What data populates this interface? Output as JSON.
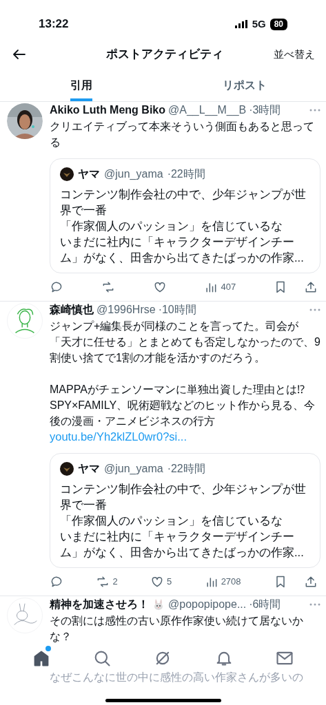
{
  "status_bar": {
    "time": "13:22",
    "network": "5G",
    "battery": "80"
  },
  "header": {
    "title": "ポストアクティビティ",
    "action": "並べ替え"
  },
  "tabs": [
    {
      "label": "引用",
      "selected": true
    },
    {
      "label": "リポスト",
      "selected": false
    }
  ],
  "posts": [
    {
      "name": "Akiko Luth Meng Biko",
      "name_badge": false,
      "handle": "@A__L__M__B",
      "time": "·3時間",
      "text": [
        "クリエイティブって本来そういう側面もあると思ってる"
      ],
      "quote": {
        "name": "ヤマ",
        "handle": "@jun_yama",
        "time": "·22時間",
        "text": [
          "コンテンツ制作会社の中で、少年ジャンプが世界で一番",
          "「作家個人のパッション」を信じているな",
          "いまだに社内に「キャラクターデザインチーム」がなく、田舎から出てきたばっかの作家..."
        ]
      },
      "stats": {
        "views": "407"
      }
    },
    {
      "name": "森崎慎也",
      "name_badge": false,
      "handle": "@1996Hrse",
      "time": "·10時間",
      "text": [
        "ジャンプ+編集長が同様のことを言ってた。司会が「天才に任せる」とまとめても否定しなかったので、9割使い捨てで1割の才能を活かすのだろう。",
        "MAPPAがチェンソーマンに単独出資した理由とは⁉ SPY×FAMILY、呪術廻戦などのヒット作から見る、今後の漫画・アニメビジネスの行方"
      ],
      "link": "youtu.be/Yh2klZL0wr0?si...",
      "quote": {
        "name": "ヤマ",
        "handle": "@jun_yama",
        "time": "·22時間",
        "text": [
          "コンテンツ制作会社の中で、少年ジャンプが世界で一番",
          "「作家個人のパッション」を信じているな",
          "いまだに社内に「キャラクターデザインチーム」がなく、田舎から出てきたばっかの作家..."
        ]
      },
      "stats": {
        "reposts": "2",
        "likes": "5",
        "views": "2708"
      }
    },
    {
      "name": "精神を加速させろ！",
      "name_badge": true,
      "handle": "@popopipope...",
      "time": "·6時間",
      "text": [
        "その割には感性の古い原作作家使い続けて居ないかな？",
        "なぜこんなに世の中に感性の高い作家さんが多いの"
      ]
    }
  ],
  "bottom_nav": [
    {
      "selected": true,
      "dot": true
    },
    {
      "selected": false,
      "dot": false
    },
    {
      "selected": false,
      "dot": false
    },
    {
      "selected": false,
      "dot": false
    },
    {
      "selected": false,
      "dot": false
    }
  ]
}
